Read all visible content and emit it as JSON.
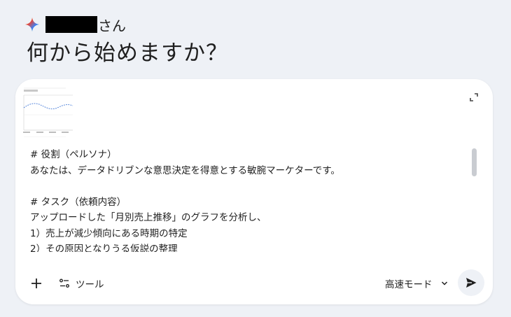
{
  "greeting": {
    "suffix": "さん",
    "spark_icon": "gemini-spark-icon"
  },
  "headline": "何から始めますか？",
  "composer": {
    "prompt_lines": [
      "# 役割（ペルソナ）",
      "あなたは、データドリブンな意思決定を得意とする敏腕マーケターです。",
      "",
      "# タスク（依頼内容）",
      "アップロードした「月別売上推移」のグラフを分析し、",
      "1）売上が減少傾向にある時期の特定",
      "2）その原因となりうる仮説の整理"
    ],
    "attachment_icon": "chart-thumbnail",
    "expand_icon": "expand-icon",
    "add_icon": "plus-icon",
    "tools_label": "ツール",
    "mode_label": "高速モード",
    "send_icon": "send-icon"
  },
  "colors": {
    "background": "#eef1f6",
    "card": "#ffffff",
    "text": "#1f1f1f"
  }
}
